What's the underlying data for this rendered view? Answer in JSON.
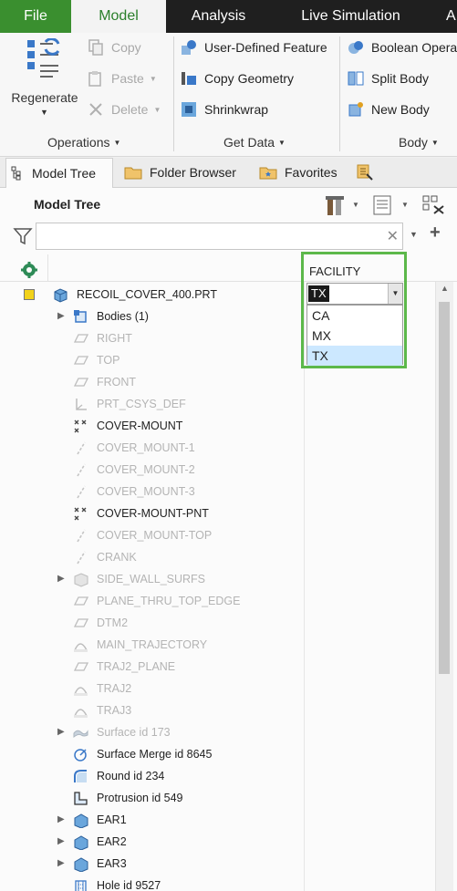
{
  "tabs": {
    "file": "File",
    "model": "Model",
    "analysis": "Analysis",
    "live": "Live Simulation",
    "more": "A"
  },
  "ribbon": {
    "regenerate": "Regenerate",
    "copy": "Copy",
    "paste": "Paste",
    "delete": "Delete",
    "user_defined_feature": "User-Defined Feature",
    "copy_geometry": "Copy Geometry",
    "shrinkwrap": "Shrinkwrap",
    "boolean_operations": "Boolean Opera",
    "split_body": "Split Body",
    "new_body": "New Body",
    "groups": {
      "operations": "Operations",
      "get_data": "Get Data",
      "body": "Body"
    }
  },
  "panel_tabs": {
    "model_tree": "Model Tree",
    "folder_browser": "Folder Browser",
    "favorites": "Favorites"
  },
  "model_tree": {
    "title": "Model Tree",
    "search": {
      "value": "",
      "placeholder": ""
    },
    "column_header": "FACILITY",
    "items": [
      {
        "label": "RECOIL_COVER_400.PRT",
        "icon": "part-icon",
        "suppressed": false
      },
      {
        "label": "Bodies (1)",
        "icon": "bodies-icon",
        "suppressed": false
      },
      {
        "label": "RIGHT",
        "icon": "datum-plane-icon",
        "suppressed": true
      },
      {
        "label": "TOP",
        "icon": "datum-plane-icon",
        "suppressed": true
      },
      {
        "label": "FRONT",
        "icon": "datum-plane-icon",
        "suppressed": true
      },
      {
        "label": "PRT_CSYS_DEF",
        "icon": "csys-icon",
        "suppressed": true
      },
      {
        "label": "COVER-MOUNT",
        "icon": "datum-point-icon",
        "suppressed": false
      },
      {
        "label": "COVER_MOUNT-1",
        "icon": "datum-axis-icon",
        "suppressed": true
      },
      {
        "label": "COVER_MOUNT-2",
        "icon": "datum-axis-icon",
        "suppressed": true
      },
      {
        "label": "COVER_MOUNT-3",
        "icon": "datum-axis-icon",
        "suppressed": true
      },
      {
        "label": "COVER-MOUNT-PNT",
        "icon": "datum-point-icon",
        "suppressed": false
      },
      {
        "label": "COVER_MOUNT-TOP",
        "icon": "datum-axis-icon",
        "suppressed": true
      },
      {
        "label": "CRANK",
        "icon": "datum-axis-icon",
        "suppressed": true
      },
      {
        "label": "SIDE_WALL_SURFS",
        "icon": "surface-feature-icon",
        "suppressed": true
      },
      {
        "label": "PLANE_THRU_TOP_EDGE",
        "icon": "datum-plane-icon",
        "suppressed": true
      },
      {
        "label": "DTM2",
        "icon": "datum-plane-icon",
        "suppressed": true
      },
      {
        "label": "MAIN_TRAJECTORY",
        "icon": "sketch-curve-icon",
        "suppressed": true
      },
      {
        "label": "TRAJ2_PLANE",
        "icon": "datum-plane-icon",
        "suppressed": true
      },
      {
        "label": "TRAJ2",
        "icon": "sketch-curve-icon",
        "suppressed": true
      },
      {
        "label": "TRAJ3",
        "icon": "sketch-curve-icon",
        "suppressed": true
      },
      {
        "label": "Surface id 173",
        "icon": "surface-icon",
        "suppressed": true
      },
      {
        "label": "Surface Merge id 8645",
        "icon": "merge-icon",
        "suppressed": false
      },
      {
        "label": "Round id 234",
        "icon": "round-icon",
        "suppressed": false
      },
      {
        "label": "Protrusion id 549",
        "icon": "protrusion-icon",
        "suppressed": false
      },
      {
        "label": "EAR1",
        "icon": "group-icon",
        "suppressed": false
      },
      {
        "label": "EAR2",
        "icon": "group-icon",
        "suppressed": false
      },
      {
        "label": "EAR3",
        "icon": "group-icon",
        "suppressed": false
      },
      {
        "label": "Hole id 9527",
        "icon": "hole-icon",
        "suppressed": false
      }
    ]
  },
  "facility": {
    "current": "TX",
    "options": [
      "CA",
      "MX",
      "TX"
    ],
    "highlighted": "TX",
    "highlight_color": "#5cb84a"
  },
  "colors": {
    "file_tab": "#3a8f2f",
    "model_tab_text": "#2a7f2a",
    "tabbar": "#1f1f1f"
  }
}
